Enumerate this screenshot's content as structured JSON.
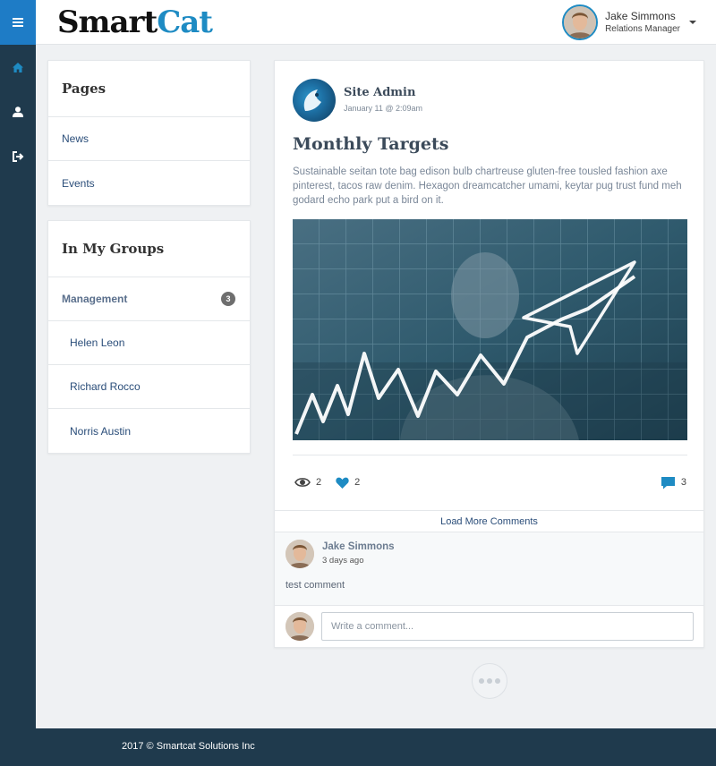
{
  "colors": {
    "accent": "#1e8bc3",
    "rail": "#1f3a4d",
    "menu_active": "#1e7cc6",
    "link": "#2a4d79"
  },
  "rail": {
    "items": [
      {
        "icon": "menu-icon"
      },
      {
        "icon": "home-icon"
      },
      {
        "icon": "user-icon"
      },
      {
        "icon": "logout-icon"
      }
    ]
  },
  "header": {
    "logo_text": "Smart",
    "logo_accent": "Cat",
    "user": {
      "name": "Jake Simmons",
      "role": "Relations Manager"
    }
  },
  "pages_panel": {
    "title": "Pages",
    "items": [
      "News",
      "Events"
    ]
  },
  "groups_panel": {
    "title": "In My Groups",
    "group": {
      "name": "Management",
      "count": "3"
    },
    "members": [
      "Helen Leon",
      "Richard Rocco",
      "Norris Austin"
    ]
  },
  "post": {
    "author": "Site Admin",
    "date": "January 11 @ 2:09am",
    "title": "Monthly Targets",
    "body": "Sustainable seitan tote bag edison bulb chartreuse gluten-free tousled fashion axe pinterest, tacos raw denim. Hexagon dreamcatcher umami, keytar pug trust fund meh godard echo park put a bird on it.",
    "stats": {
      "views": "2",
      "likes": "2",
      "comments": "3"
    },
    "load_more_label": "Load More Comments",
    "comment": {
      "author": "Jake Simmons",
      "time": "3 days ago",
      "text": "test comment"
    },
    "comment_placeholder": "Write a comment..."
  },
  "footer": {
    "text": "2017 © Smartcat Solutions Inc"
  }
}
